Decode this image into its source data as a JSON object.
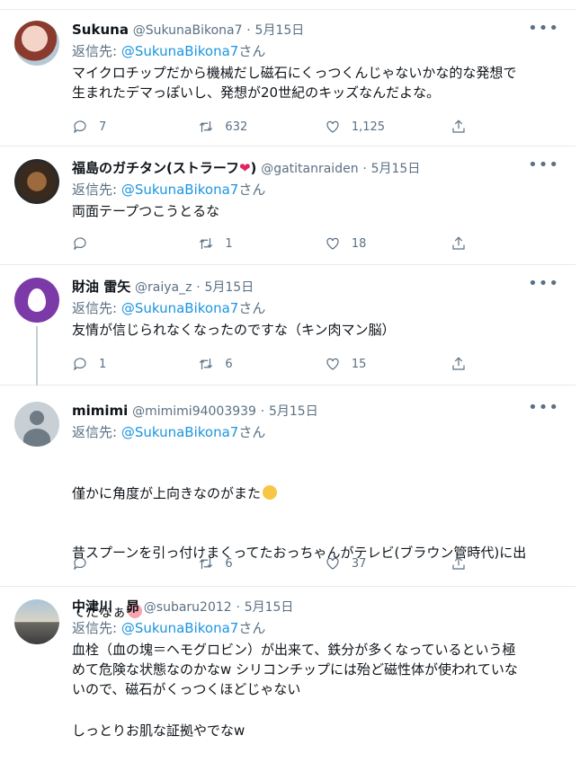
{
  "tweets": [
    {
      "name": "Sukuna",
      "handle": "@SukunaBikona7",
      "date": "5月15日",
      "reply_prefix": "返信先: ",
      "reply_handle": "@SukunaBikona7",
      "reply_suffix": "さん",
      "text": "マイクロチップだから機械だし磁石にくっつくんじゃないかな的な発想で\n生まれたデマっぽいし、発想が20世紀のキッズなんだよな。",
      "replies": "7",
      "retweets": "632",
      "likes": "1,125"
    },
    {
      "name": "福島のガチタン(ストラーフ",
      "handle": "@gatitanraiden",
      "date": "5月15日",
      "reply_prefix": "返信先: ",
      "reply_handle": "@SukunaBikona7",
      "reply_suffix": "さん",
      "text": "両面テープつこうとるな",
      "replies": "",
      "retweets": "1",
      "likes": "18"
    },
    {
      "name": "財油 雷矢",
      "handle": "@raiya_z",
      "date": "5月15日",
      "reply_prefix": "返信先: ",
      "reply_handle": "@SukunaBikona7",
      "reply_suffix": "さん",
      "text": "友情が信じられなくなったのですな（キン肉マン脳）",
      "replies": "1",
      "retweets": "6",
      "likes": "15"
    },
    {
      "name": "mimimi",
      "handle": "@mimimi94003939",
      "date": "5月15日",
      "reply_prefix": "返信先: ",
      "reply_handle": "@SukunaBikona7",
      "reply_suffix": "さん",
      "text_line1": "僅かに角度が上向きなのがまた",
      "text_line2": "昔スプーンを引っ付けまくってたおっちゃんがテレビ(ブラウン管時代)に出",
      "text_line3": "てたなぁ",
      "text_line4": "しっとりお肌な証拠やでなw",
      "replies": "",
      "retweets": "6",
      "likes": "37"
    },
    {
      "name": "中津川　昴",
      "handle": "@subaru2012",
      "date": "5月15日",
      "reply_prefix": "返信先: ",
      "reply_handle": "@SukunaBikona7",
      "reply_suffix": "さん",
      "text": "血栓（血の塊＝ヘモグロビン）が出来て、鉄分が多くなっているという極\nめて危険な状態なのかなw シリコンチップには殆ど磁性体が使われていな\nいので、磁石がくっつくほどじゃない"
    }
  ],
  "separator_dot": "·",
  "more_glyph": "•••",
  "icons": [
    "reply-icon",
    "retweet-icon",
    "like-icon",
    "share-icon",
    "more-icon"
  ],
  "colors": {
    "link": "#1b95e0",
    "muted": "#5b7083",
    "heart": "#e0245e"
  }
}
